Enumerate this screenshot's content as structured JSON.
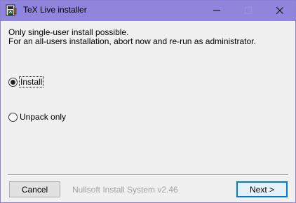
{
  "window": {
    "title": "TeX Live installer",
    "accent_color": "#8f85dc"
  },
  "titlebar": {
    "icon": "installer-package-icon",
    "minimize_icon": "minimize-icon",
    "maximize_icon": "maximize-icon",
    "close_icon": "close-icon"
  },
  "message": {
    "line1": "Only single-user install possible.",
    "line2": "For an all-users installation, abort now and re-run as administrator."
  },
  "options": [
    {
      "label": "Install",
      "checked": true
    },
    {
      "label": "Unpack only",
      "checked": false
    }
  ],
  "footer": {
    "cancel_label": "Cancel",
    "branding": "Nullsoft Install System v2.46",
    "next_label": "Next >"
  }
}
